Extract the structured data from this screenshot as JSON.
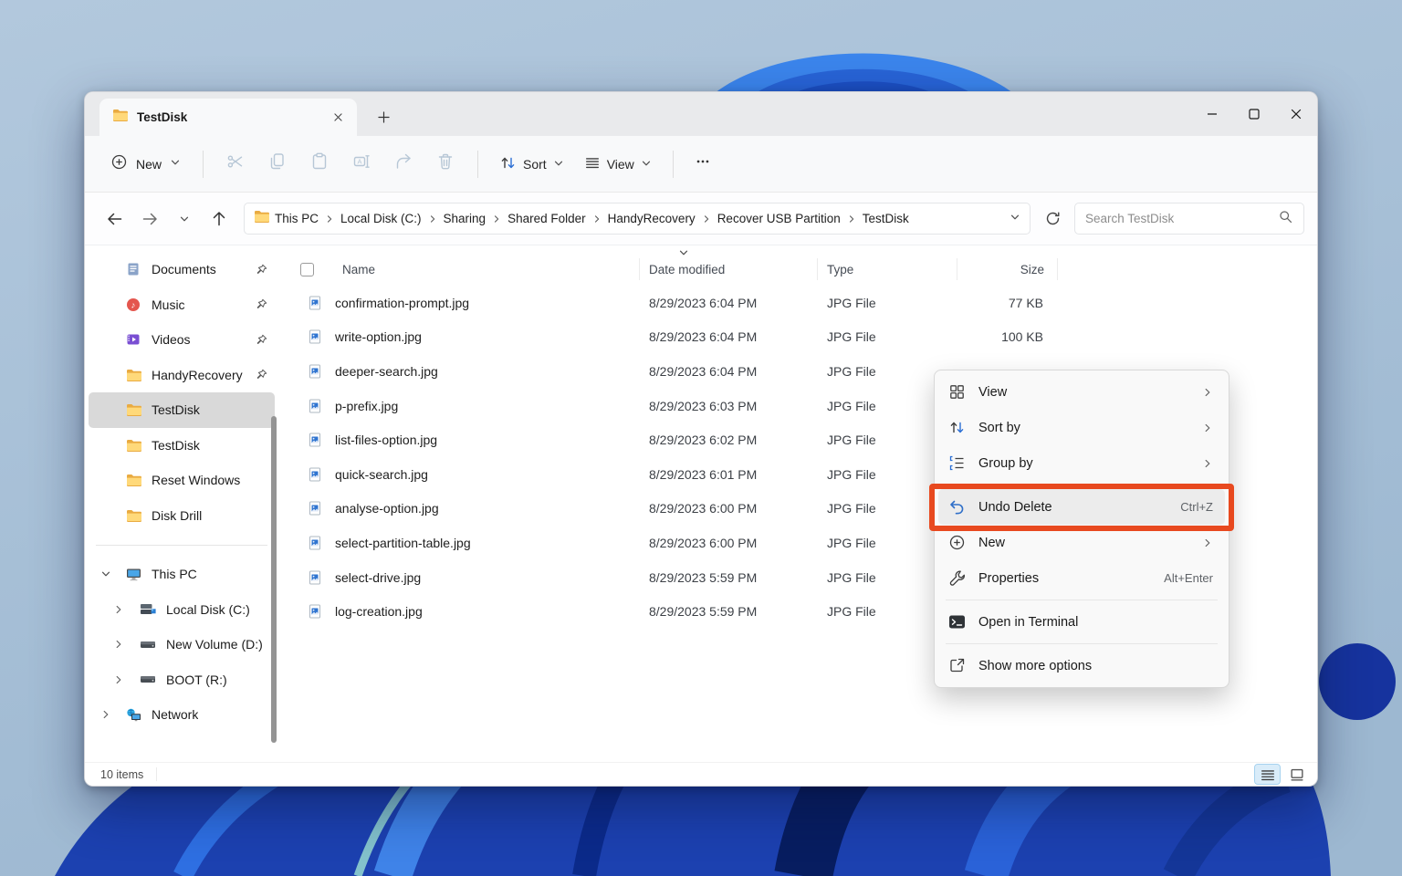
{
  "window": {
    "tab_title": "TestDisk"
  },
  "toolbar": {
    "new_label": "New",
    "sort_label": "Sort",
    "view_label": "View"
  },
  "address_bar": {
    "breadcrumbs": [
      "This PC",
      "Local Disk (C:)",
      "Sharing",
      "Shared Folder",
      "HandyRecovery",
      "Recover USB Partition",
      "TestDisk"
    ],
    "search_placeholder": "Search TestDisk"
  },
  "sidebar": {
    "pinned": [
      {
        "label": "Documents",
        "icon": "documents",
        "pinned": true
      },
      {
        "label": "Music",
        "icon": "music",
        "pinned": true
      },
      {
        "label": "Videos",
        "icon": "videos",
        "pinned": true
      },
      {
        "label": "HandyRecovery",
        "icon": "folder",
        "pinned": true
      },
      {
        "label": "TestDisk",
        "icon": "folder",
        "selected": true
      },
      {
        "label": "TestDisk",
        "icon": "folder"
      },
      {
        "label": "Reset Windows",
        "icon": "folder"
      },
      {
        "label": "Disk Drill",
        "icon": "folder"
      }
    ],
    "tree": [
      {
        "label": "This PC",
        "icon": "monitor",
        "level": 0,
        "expanded": true
      },
      {
        "label": "Local Disk (C:)",
        "icon": "drive-win",
        "level": 1
      },
      {
        "label": "New Volume (D:)",
        "icon": "drive",
        "level": 1
      },
      {
        "label": "BOOT (R:)",
        "icon": "drive",
        "level": 1
      },
      {
        "label": "Network",
        "icon": "network",
        "level": 0
      }
    ]
  },
  "file_list": {
    "columns": [
      "Name",
      "Date modified",
      "Type",
      "Size"
    ],
    "sorted_by": "Date modified",
    "files": [
      {
        "name": "confirmation-prompt.jpg",
        "date": "8/29/2023 6:04 PM",
        "type": "JPG File",
        "size": "77 KB"
      },
      {
        "name": "write-option.jpg",
        "date": "8/29/2023 6:04 PM",
        "type": "JPG File",
        "size": "100 KB"
      },
      {
        "name": "deeper-search.jpg",
        "date": "8/29/2023 6:04 PM",
        "type": "JPG File",
        "size": ""
      },
      {
        "name": "p-prefix.jpg",
        "date": "8/29/2023 6:03 PM",
        "type": "JPG File",
        "size": ""
      },
      {
        "name": "list-files-option.jpg",
        "date": "8/29/2023 6:02 PM",
        "type": "JPG File",
        "size": ""
      },
      {
        "name": "quick-search.jpg",
        "date": "8/29/2023 6:01 PM",
        "type": "JPG File",
        "size": ""
      },
      {
        "name": "analyse-option.jpg",
        "date": "8/29/2023 6:00 PM",
        "type": "JPG File",
        "size": ""
      },
      {
        "name": "select-partition-table.jpg",
        "date": "8/29/2023 6:00 PM",
        "type": "JPG File",
        "size": ""
      },
      {
        "name": "select-drive.jpg",
        "date": "8/29/2023 5:59 PM",
        "type": "JPG File",
        "size": ""
      },
      {
        "name": "log-creation.jpg",
        "date": "8/29/2023 5:59 PM",
        "type": "JPG File",
        "size": ""
      }
    ]
  },
  "context_menu": {
    "annotation_color": "#e8491f",
    "items": [
      {
        "label": "View",
        "icon": "grid",
        "submenu": true
      },
      {
        "label": "Sort by",
        "icon": "sort-arrows",
        "submenu": true
      },
      {
        "label": "Group by",
        "icon": "group",
        "submenu": true
      },
      {
        "type": "divider"
      },
      {
        "label": "Undo Delete",
        "icon": "undo",
        "shortcut": "Ctrl+Z",
        "highlighted": true
      },
      {
        "label": "New",
        "icon": "plus-circle",
        "submenu": true
      },
      {
        "label": "Properties",
        "icon": "wrench",
        "shortcut": "Alt+Enter"
      },
      {
        "type": "divider"
      },
      {
        "label": "Open in Terminal",
        "icon": "terminal"
      },
      {
        "type": "divider"
      },
      {
        "label": "Show more options",
        "icon": "show-more"
      }
    ]
  },
  "status_bar": {
    "items_count": "10 items"
  },
  "colors": {
    "accent_blue": "#2b6fd4",
    "annotation": "#e8491f",
    "selected_gray": "#d9d9d9"
  }
}
